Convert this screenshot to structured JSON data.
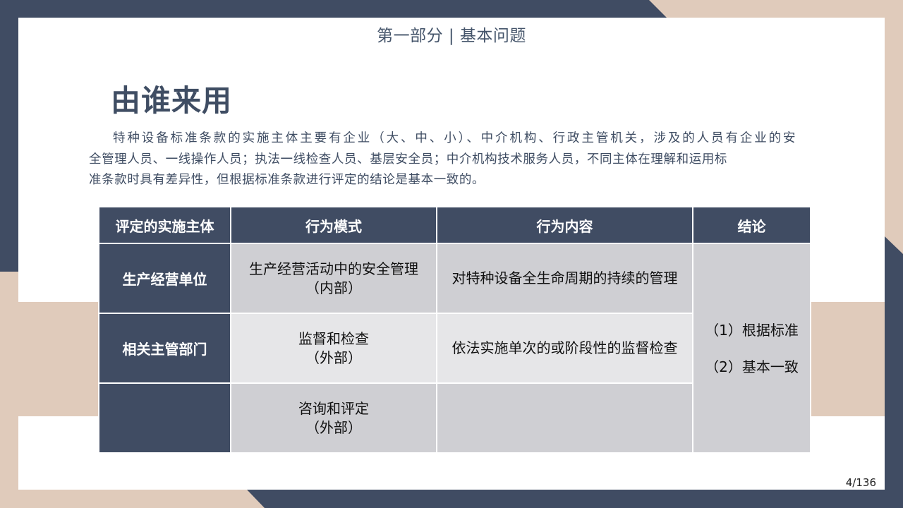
{
  "colors": {
    "navy": "#404c63",
    "beige": "#e0cbbb",
    "title_text": "#3f4d63",
    "cell_dark": "#cfcfd3",
    "cell_light": "#e6e6e8"
  },
  "header": {
    "section_title": "第一部分 | 基本问题"
  },
  "main": {
    "heading": "由谁来用",
    "paragraph_lines": [
      "特种设备标准条款的实施主体主要有企业（大、中、小）、中介机构、行政主管机关，涉及的人员有企业的安",
      "全管理人员、一线操作人员；执法一线检查人员、基层安全员；中介机构技术服务人员，不同主体在理解和运用标",
      "准条款时具有差异性，但根据标准条款进行评定的结论是基本一致的。"
    ]
  },
  "table": {
    "headers": [
      "评定的实施主体",
      "行为模式",
      "行为内容",
      "结论"
    ],
    "rows": [
      {
        "subject": "生产经营单位",
        "mode_line1": "生产经营活动中的安全管理",
        "mode_line2": "（内部）",
        "content": "对特种设备全生命周期的持续的管理"
      },
      {
        "subject": "相关主管部门",
        "mode_line1": "监督和检查",
        "mode_line2": "（外部）",
        "content": "依法实施单次的或阶段性的监督检查"
      },
      {
        "subject": "",
        "mode_line1": "咨询和评定",
        "mode_line2": "（外部）",
        "content": ""
      }
    ],
    "conclusion_lines": [
      "（1）根据标准",
      "（2）基本一致"
    ]
  },
  "footer": {
    "page_number": "4/136"
  }
}
